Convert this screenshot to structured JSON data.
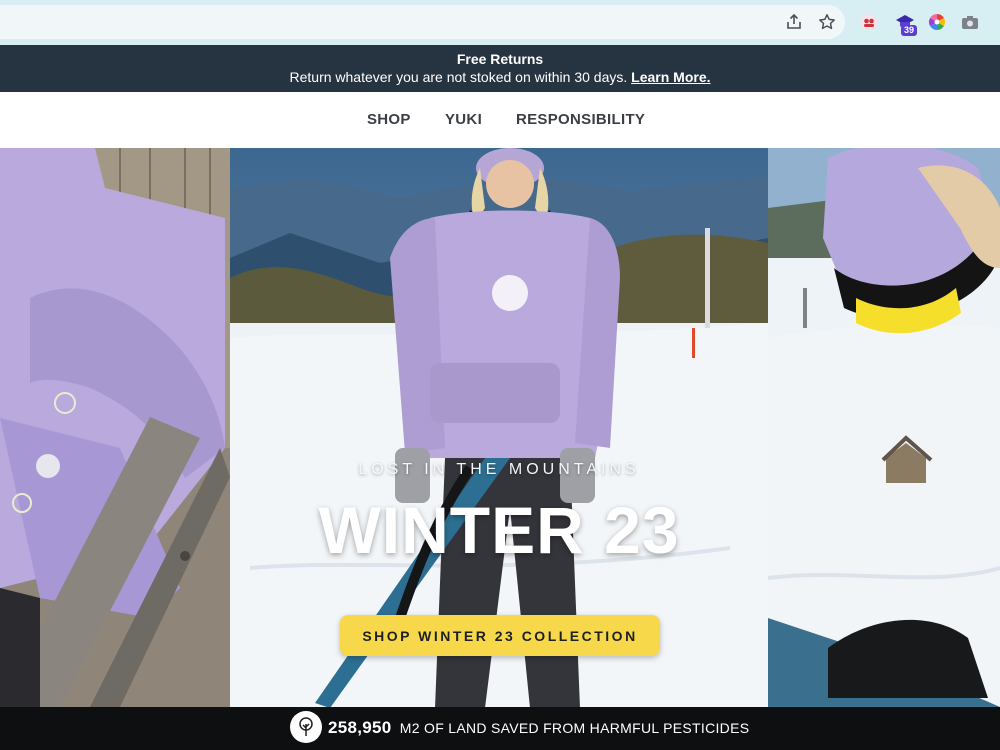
{
  "browser": {
    "icons": [
      "share-icon",
      "star-icon",
      "extension-people-icon",
      "extension-hat-icon",
      "extension-color-wheel-icon",
      "camera-icon"
    ],
    "extension_badge": "39"
  },
  "announcement": {
    "title": "Free Returns",
    "message": "Return whatever you are not stoked on within 30 days.",
    "link": "Learn More."
  },
  "nav": {
    "items": [
      {
        "label": "SHOP"
      },
      {
        "label": "YUKI"
      },
      {
        "label": "RESPONSIBILITY"
      }
    ]
  },
  "hero": {
    "eyebrow": "LOST IN THE MOUNTAINS",
    "title": "WINTER 23",
    "cta": "SHOP WINTER 23 COLLECTION"
  },
  "impact": {
    "count": "258,950",
    "text": "M2 OF LAND SAVED FROM HARMFUL PESTICIDES",
    "icon": "tree-icon"
  },
  "colors": {
    "announcement_bg": "#263340",
    "cta_bg": "#f6d84a",
    "impact_bg": "#0e0f10",
    "hoodie_lavender": "#b9a9dd"
  }
}
